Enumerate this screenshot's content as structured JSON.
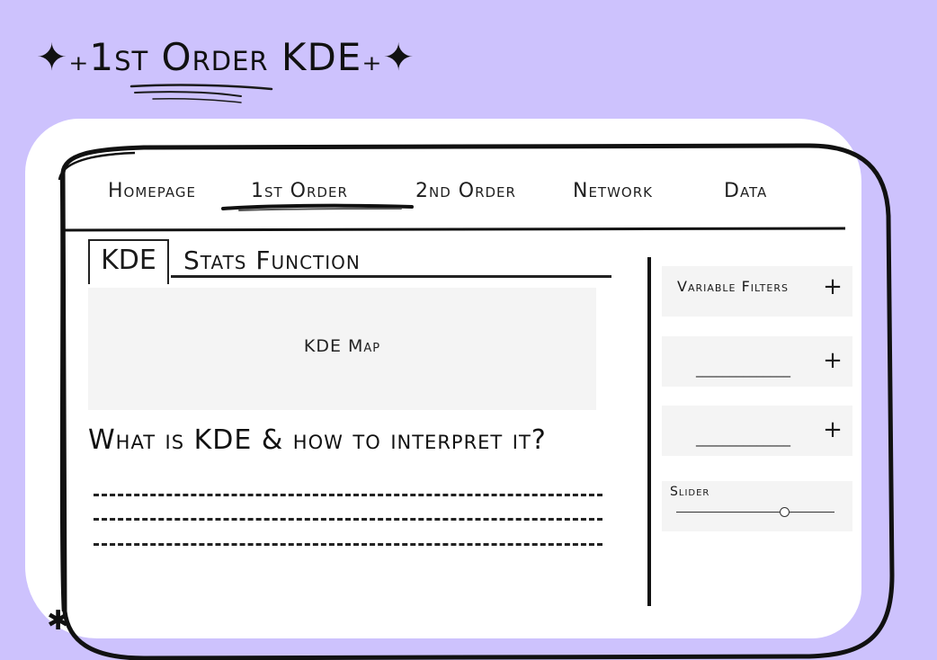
{
  "page": {
    "title": "✦₊1st Order KDE₊✦"
  },
  "nav": {
    "items": [
      {
        "label": "Homepage"
      },
      {
        "label": "1st Order"
      },
      {
        "label": "2nd Order"
      },
      {
        "label": "Network"
      },
      {
        "label": "Data"
      }
    ],
    "active_index": 1
  },
  "tabs": {
    "kde_label": "KDE",
    "stats_label": "Stats Function"
  },
  "main": {
    "map_label": "KDE Map",
    "heading": "What is KDE & how to interpret it?"
  },
  "sidebar": {
    "variable_filters_label": "Variable Filters",
    "filter2_blank": "______________",
    "filter3_blank": "______________",
    "plus_symbol": "+",
    "slider_label": "Slider",
    "slider_value": 0.69
  },
  "decor": {
    "asterisk": "✱"
  },
  "colors": {
    "background": "#cdc2fd",
    "card": "#ffffff",
    "panel": "#f4f4f4",
    "ink": "#111111"
  }
}
